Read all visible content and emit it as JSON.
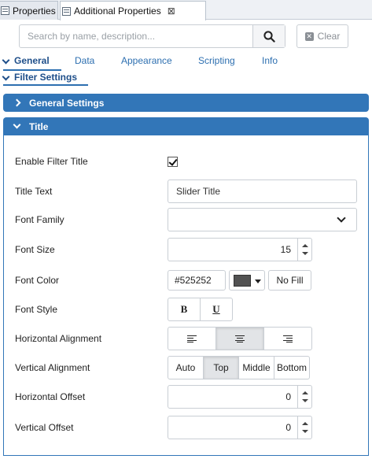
{
  "tabs": [
    {
      "label": "Properties",
      "icon": "properties-icon"
    },
    {
      "label": "Additional Properties",
      "icon": "properties-icon",
      "close": "⊠"
    }
  ],
  "search": {
    "placeholder": "Search by name, description...",
    "value": ""
  },
  "clear_label": "Clear",
  "categories": [
    "General",
    "Data",
    "Appearance",
    "Scripting",
    "Info"
  ],
  "active_category": "General",
  "group_label": "Filter Settings",
  "sections": {
    "general": {
      "label": "General Settings",
      "expanded": false
    },
    "title": {
      "label": "Title",
      "expanded": true
    }
  },
  "fields": {
    "enable_filter_title": {
      "label": "Enable Filter Title",
      "checked": true
    },
    "title_text": {
      "label": "Title Text",
      "value": "Slider Title"
    },
    "font_family": {
      "label": "Font Family",
      "value": ""
    },
    "font_size": {
      "label": "Font Size",
      "value": "15"
    },
    "font_color": {
      "label": "Font Color",
      "value": "#525252",
      "swatch": "#525252",
      "no_fill_label": "No Fill"
    },
    "font_style": {
      "label": "Font Style",
      "bold_label": "B",
      "underline_label": "U"
    },
    "horizontal_alignment": {
      "label": "Horizontal Alignment",
      "options": [
        "left",
        "center",
        "right"
      ],
      "selected": "center"
    },
    "vertical_alignment": {
      "label": "Vertical Alignment",
      "options": [
        "Auto",
        "Top",
        "Middle",
        "Bottom"
      ],
      "selected": "Top"
    },
    "horizontal_offset": {
      "label": "Horizontal Offset",
      "value": "0"
    },
    "vertical_offset": {
      "label": "Vertical Offset",
      "value": "0"
    }
  },
  "colors": {
    "accent": "#3276b8",
    "link": "#2d6fb0"
  }
}
